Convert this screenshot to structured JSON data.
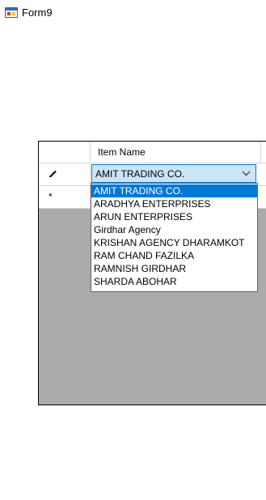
{
  "window": {
    "title": "Form9"
  },
  "grid": {
    "columns": [
      {
        "header": "Item Name"
      }
    ],
    "rows": [
      {
        "indicator": "edit",
        "item_name": "AMIT TRADING CO."
      },
      {
        "indicator": "new",
        "marker": "*",
        "item_name": ""
      }
    ]
  },
  "combo": {
    "value": "AMIT TRADING CO.",
    "options": [
      "AMIT TRADING CO.",
      "ARADHYA ENTERPRISES",
      "ARUN ENTERPRISES",
      "Girdhar Agency",
      "KRISHAN AGENCY DHARAMKOT",
      "RAM CHAND FAZILKA",
      "RAMNISH GIRDHAR",
      "SHARDA ABOHAR"
    ],
    "selected_index": 0
  },
  "icons": {
    "app": "form-app-icon",
    "edit_row": "pencil-icon",
    "new_row": "asterisk-icon",
    "dropdown": "chevron-down-icon"
  },
  "colors": {
    "selection": "#0078d7",
    "combo_bg": "#cce4f7",
    "grid_bg": "#ababab"
  }
}
